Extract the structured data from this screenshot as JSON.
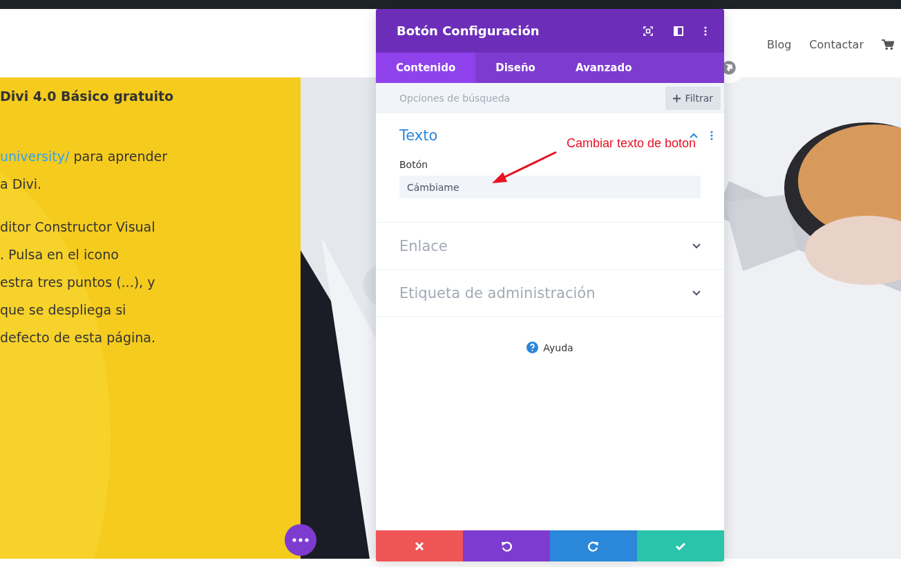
{
  "site_header": {
    "nav": [
      {
        "label": "Blog"
      },
      {
        "label": "Contactar"
      }
    ]
  },
  "content": {
    "heading": "Divi 4.0 Básico gratuito",
    "paragraphs": [
      [
        {
          "link": "university/",
          "text": "para aprender"
        },
        {
          "text": "a Divi."
        }
      ],
      [
        {
          "text": "ditor Constructor Visual"
        },
        {
          "text": ". Pulsa en el icono"
        },
        {
          "text": "estra tres puntos (...), y"
        },
        {
          "text": "que se despliega si"
        },
        {
          "text": "defecto de esta página."
        }
      ]
    ]
  },
  "panel": {
    "title": "Botón Configuración",
    "tabs": [
      {
        "label": "Contenido",
        "selected": true
      },
      {
        "label": "Diseño",
        "selected": false
      },
      {
        "label": "Avanzado",
        "selected": false
      }
    ],
    "search": {
      "placeholder": "Opciones de búsqueda"
    },
    "filter_button": "Filtrar",
    "sections": [
      {
        "title": "Texto",
        "expanded": true,
        "fields": [
          {
            "label": "Botón",
            "value": "Cámbiame"
          }
        ]
      },
      {
        "title": "Enlace",
        "expanded": false
      },
      {
        "title": "Etiqueta de administración",
        "expanded": false
      }
    ],
    "help": "Ayuda",
    "footer_buttons": [
      {
        "kind": "discard"
      },
      {
        "kind": "undo"
      },
      {
        "kind": "redo"
      },
      {
        "kind": "save"
      }
    ]
  },
  "annotation": {
    "text": "Cambiar texto de boton"
  }
}
